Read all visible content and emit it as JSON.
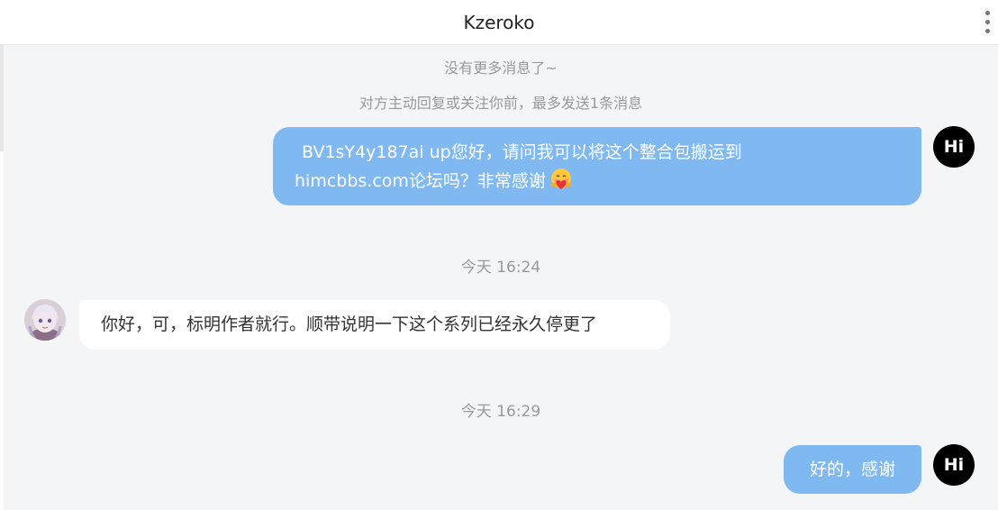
{
  "header": {
    "title": "Kzeroko"
  },
  "system": {
    "no_more": "没有更多消息了~",
    "limit_notice": "对方主动回复或关注你前，最多发送1条消息"
  },
  "messages": [
    {
      "side": "self",
      "avatar_text": "Hi",
      "lines": [
        "BV1sY4y187ai  up您好，请问我可以将这个整合包搬运到",
        "himcbbs.com论坛吗？非常感谢"
      ],
      "emoji": "hugging-heart-emoji"
    },
    {
      "type": "time",
      "text": "今天 16:24"
    },
    {
      "side": "peer",
      "text": "你好，可，标明作者就行。顺带说明一下这个系列已经永久停更了"
    },
    {
      "type": "time",
      "text": "今天 16:29"
    },
    {
      "side": "self",
      "avatar_text": "Hi",
      "text": "好的，感谢"
    }
  ],
  "colors": {
    "outgoing_bubble": "#80b9f2",
    "incoming_bubble": "#ffffff",
    "chat_background": "#f4f5f7",
    "system_text": "#999999"
  }
}
